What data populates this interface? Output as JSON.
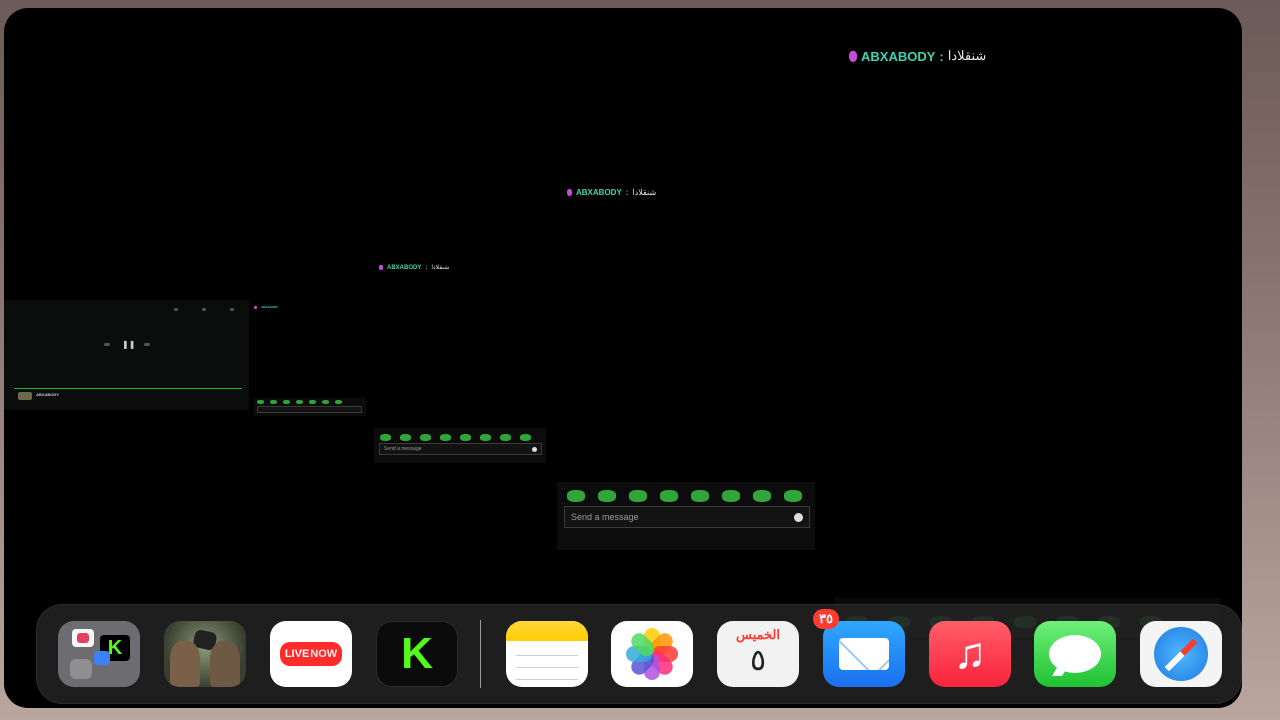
{
  "stream": {
    "chat_username": "ABXABODY",
    "chat_message": "شنقلادا",
    "separator": ":",
    "input_placeholder": "Send a message",
    "mini_channel": "ABXABODY",
    "accent_color": "#3fd3b1",
    "brand_green": "#53fc18"
  },
  "dock": {
    "apps": [
      {
        "name": "Folder (Instagram, Kick, Settings)",
        "icon": "folder-icon"
      },
      {
        "name": "Game",
        "icon": "game-icon"
      },
      {
        "name": "Live Now",
        "icon": "live-now-icon",
        "label_live": "LIVE",
        "label_now": "NOW"
      },
      {
        "name": "Kick",
        "icon": "kick-icon",
        "glyph": "K"
      },
      {
        "name": "Notes",
        "icon": "notes-icon"
      },
      {
        "name": "Photos",
        "icon": "photos-icon"
      },
      {
        "name": "Calendar",
        "icon": "calendar-icon",
        "weekday": "الخميس",
        "date": "٥"
      },
      {
        "name": "Mail",
        "icon": "mail-icon",
        "badge": "٣٥"
      },
      {
        "name": "Music",
        "icon": "music-icon",
        "glyph": "♫"
      },
      {
        "name": "Messages",
        "icon": "messages-icon"
      },
      {
        "name": "Safari",
        "icon": "safari-icon"
      }
    ]
  }
}
